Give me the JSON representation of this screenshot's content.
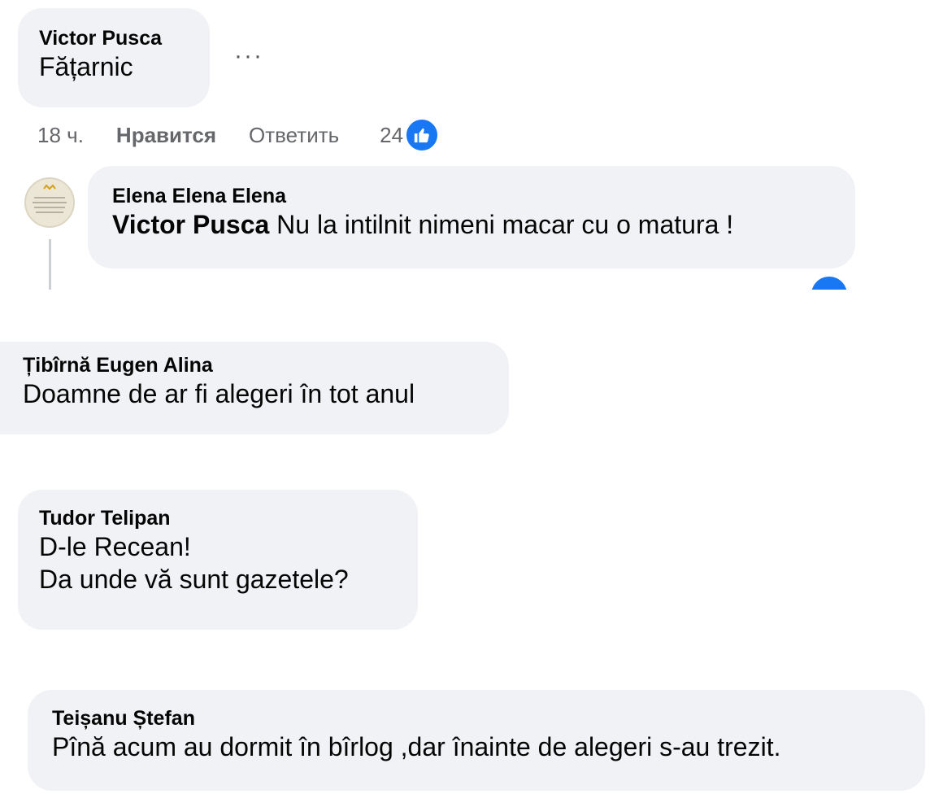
{
  "comments": [
    {
      "author": "Victor Pusca",
      "text": "Fățarnic",
      "more": "···",
      "time": "18 ч.",
      "like_label": "Нравится",
      "reply_label": "Ответить",
      "reaction_count": "24"
    },
    {
      "author": "Țibîrnă Eugen Alina",
      "text": "Doamne de ar fi alegeri în tot anul"
    },
    {
      "author": "Tudor Telipan",
      "text_line1": "D-le Recean!",
      "text_line2": "Da unde vă sunt gazetele?"
    },
    {
      "author": "Teișanu Ștefan",
      "text": "Pînă acum au dormit în bîrlog ,dar înainte de alegeri s-au trezit."
    }
  ],
  "reply": {
    "author": "Elena Elena Elena",
    "mention": "Victor Pusca",
    "text": " Nu la intilnit nimeni macar cu o matura !"
  },
  "colors": {
    "bubble": "#f0f2f5",
    "meta_text": "#65676b",
    "like_blue": "#1877f2"
  },
  "icons": [
    "like-icon",
    "more-options-icon",
    "avatar"
  ]
}
